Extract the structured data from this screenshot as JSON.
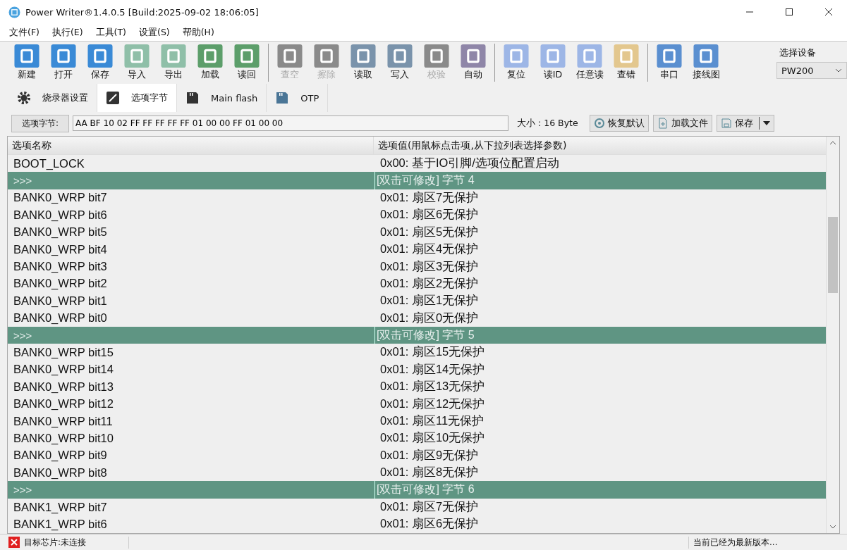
{
  "window": {
    "title": "Power Writer®1.4.0.5 [Build:2025-09-02 18:06:05]"
  },
  "menu": [
    "文件(F)",
    "执行(E)",
    "工具(T)",
    "设置(S)",
    "帮助(H)"
  ],
  "toolbar": [
    {
      "buttons": [
        {
          "label": "新建",
          "color": "#3a8ad6",
          "disabled": false
        },
        {
          "label": "打开",
          "color": "#3a8ad6",
          "disabled": false
        },
        {
          "label": "保存",
          "color": "#3a8ad6",
          "disabled": false
        },
        {
          "label": "导入",
          "color": "#8fbfa8",
          "disabled": false
        },
        {
          "label": "导出",
          "color": "#8fbfa8",
          "disabled": false
        },
        {
          "label": "加载",
          "color": "#5c9e6a",
          "disabled": false
        },
        {
          "label": "读回",
          "color": "#5c9e6a",
          "disabled": false
        }
      ]
    },
    {
      "buttons": [
        {
          "label": "查空",
          "color": "#8a8a8a",
          "disabled": true
        },
        {
          "label": "擦除",
          "color": "#8a8a8a",
          "disabled": true
        },
        {
          "label": "读取",
          "color": "#7a93ab",
          "disabled": false
        },
        {
          "label": "写入",
          "color": "#7a93ab",
          "disabled": false
        },
        {
          "label": "校验",
          "color": "#8a8a8a",
          "disabled": true
        },
        {
          "label": "自动",
          "color": "#8f86a8",
          "disabled": false
        }
      ]
    },
    {
      "buttons": [
        {
          "label": "复位",
          "color": "#9db6e6",
          "disabled": false
        },
        {
          "label": "读ID",
          "color": "#9db6e6",
          "disabled": false
        },
        {
          "label": "任意读",
          "color": "#9db6e6",
          "disabled": false
        },
        {
          "label": "查错",
          "color": "#e3c78e",
          "disabled": false
        }
      ]
    },
    {
      "buttons": [
        {
          "label": "串口",
          "color": "#5a8fd0",
          "disabled": false
        },
        {
          "label": "接线图",
          "color": "#5a8fd0",
          "disabled": false
        }
      ]
    }
  ],
  "device": {
    "label": "选择设备",
    "value": "PW200"
  },
  "tabs": [
    {
      "label": "烧录器设置",
      "selected": false
    },
    {
      "label": "选项字节",
      "selected": true
    },
    {
      "label": "Main flash",
      "selected": false
    },
    {
      "label": "OTP",
      "selected": false
    }
  ],
  "option_bar": {
    "label": "选项字节:",
    "value": "AA BF 10 02 FF FF FF FF FF 01 00 00 FF 01 00 00",
    "size": "大小 : 16 Byte",
    "buttons": [
      "恢复默认",
      "加载文件",
      "保存"
    ]
  },
  "table": {
    "columns": [
      "选项名称",
      "选项值(用鼠标点击项,从下拉列表选择参数)"
    ],
    "rows": [
      {
        "kind": "item",
        "name": "BOOT_LOCK",
        "value": "0x00: 基于IO引脚/选项位配置启动"
      },
      {
        "kind": "section",
        "name": ">>>",
        "value": "[双击可修改] 字节 4"
      },
      {
        "kind": "item",
        "name": "BANK0_WRP bit7",
        "value": "0x01: 扇区7无保护"
      },
      {
        "kind": "item",
        "name": "BANK0_WRP bit6",
        "value": "0x01: 扇区6无保护"
      },
      {
        "kind": "item",
        "name": "BANK0_WRP bit5",
        "value": "0x01: 扇区5无保护"
      },
      {
        "kind": "item",
        "name": "BANK0_WRP bit4",
        "value": "0x01: 扇区4无保护"
      },
      {
        "kind": "item",
        "name": "BANK0_WRP bit3",
        "value": "0x01: 扇区3无保护"
      },
      {
        "kind": "item",
        "name": "BANK0_WRP bit2",
        "value": "0x01: 扇区2无保护"
      },
      {
        "kind": "item",
        "name": "BANK0_WRP bit1",
        "value": "0x01: 扇区1无保护"
      },
      {
        "kind": "item",
        "name": "BANK0_WRP bit0",
        "value": "0x01: 扇区0无保护"
      },
      {
        "kind": "section",
        "name": ">>>",
        "value": "[双击可修改] 字节 5"
      },
      {
        "kind": "item",
        "name": "BANK0_WRP bit15",
        "value": "0x01: 扇区15无保护"
      },
      {
        "kind": "item",
        "name": "BANK0_WRP bit14",
        "value": "0x01: 扇区14无保护"
      },
      {
        "kind": "item",
        "name": "BANK0_WRP bit13",
        "value": "0x01: 扇区13无保护"
      },
      {
        "kind": "item",
        "name": "BANK0_WRP bit12",
        "value": "0x01: 扇区12无保护"
      },
      {
        "kind": "item",
        "name": "BANK0_WRP bit11",
        "value": "0x01: 扇区11无保护"
      },
      {
        "kind": "item",
        "name": "BANK0_WRP bit10",
        "value": "0x01: 扇区10无保护"
      },
      {
        "kind": "item",
        "name": "BANK0_WRP bit9",
        "value": "0x01: 扇区9无保护"
      },
      {
        "kind": "item",
        "name": "BANK0_WRP bit8",
        "value": "0x01: 扇区8无保护"
      },
      {
        "kind": "section",
        "name": ">>>",
        "value": "[双击可修改] 字节 6"
      },
      {
        "kind": "item",
        "name": "BANK1_WRP bit7",
        "value": "0x01: 扇区7无保护"
      },
      {
        "kind": "item",
        "name": "BANK1_WRP bit6",
        "value": "0x01: 扇区6无保护"
      }
    ]
  },
  "status_bar": {
    "chip": "目标芯片:未连接",
    "version": "当前已经为最新版本..."
  }
}
